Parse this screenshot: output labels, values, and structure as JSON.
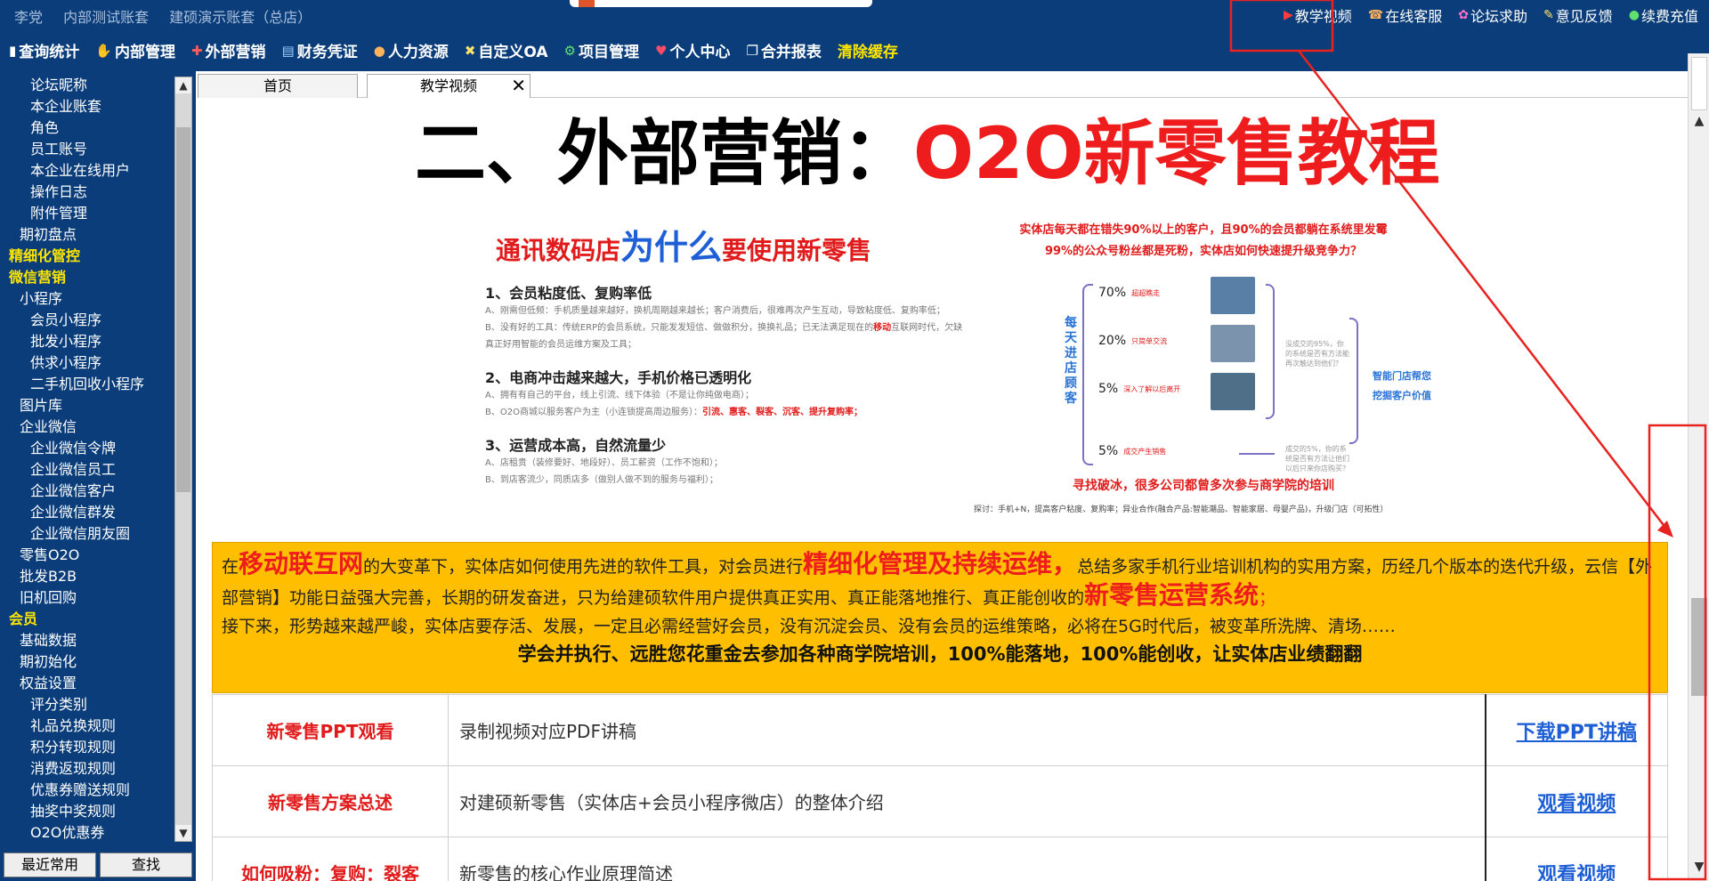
{
  "header": {
    "account_user": "李党",
    "account_test": "内部测试账套",
    "account_demo": "建硕演示账套（总店）",
    "util_links": {
      "video": "教学视频",
      "service": "在线客服",
      "forum": "论坛求助",
      "feedback": "意见反馈",
      "renew": "续费充值"
    },
    "nav": {
      "query": "查询统计",
      "internal": "内部管理",
      "marketing": "外部营销",
      "finance": "财务凭证",
      "hr": "人力资源",
      "oa": "自定义OA",
      "project": "项目管理",
      "personal": "个人中心",
      "report": "合并报表",
      "clear": "清除缓存"
    }
  },
  "sidebar": {
    "items": [
      "论坛昵称",
      "本企业账套",
      "角色",
      "员工账号",
      "本企业在线用户",
      "操作日志",
      "附件管理",
      "期初盘点",
      "精细化管控",
      "微信营销",
      "小程序",
      "会员小程序",
      "批发小程序",
      "供求小程序",
      "二手机回收小程序",
      "图片库",
      "企业微信",
      "企业微信令牌",
      "企业微信员工",
      "企业微信客户",
      "企业微信群发",
      "企业微信朋友圈",
      "零售O2O",
      "批发B2B",
      "旧机回购",
      "会员",
      "基础数据",
      "期初始化",
      "权益设置",
      "评分类别",
      "礼品兑换规则",
      "积分转现规则",
      "消费返现规则",
      "优惠券赠送规则",
      "抽奖中奖规则",
      "O2O优惠券"
    ],
    "bottom": {
      "recent": "最近常用",
      "search": "查找"
    }
  },
  "tabs": {
    "home": "首页",
    "video": "教学视频"
  },
  "content": {
    "title_black": "二、外部营销：",
    "title_red": "O2O新零售教程",
    "slide_left": {
      "title_a": "通讯数码店",
      "title_b": "为什么",
      "title_c": "要使用新零售",
      "p1": "1、会员粘度低、复购率低",
      "p1_a": "A、刚需但低频：手机质量越来越好，换机周期越来越长；客户消费后，很难再次产生互动，导致粘度低、复购率低；",
      "p1_b1": "B、没有好的工具：传统ERP的会员系统，只能发发短信、做做积分，换换礼品；已无法满足现在的",
      "p1_b_hl": "移动",
      "p1_b2": "互联网时代，欠缺真正好用智能的会员运维方案及工具；",
      "p2": "2、电商冲击越来越大，手机价格已透明化",
      "p2_a": "A、拥有有自己的平台，线上引流、线下体验（不是让你纯做电商）；",
      "p2_b1": "B、O2O商城以服务客户为主（小连锁提高周边服务）：",
      "p2_b_hl": "引流、惠客、裂客、沉客、提升复购率；",
      "p3": "3、运营成本高，自然流量少",
      "p3_a": "A、店租贵（装修要好、地段好）、员工薪资（工作不饱和）；",
      "p3_b": "B、到店客流少，同质店多（做别人做不到的服务与福利）；"
    },
    "slide_right": {
      "head_1": "实体店每天都在错失90%以上的客户，且90%的会员都躺在系统里发霉",
      "head_2": "99%的公众号粉丝都是死粉，实体店如何快速提升级竞争力？",
      "vertical": "每天进店顾客",
      "rows": [
        {
          "pct": "70%",
          "label": "超超瞧走"
        },
        {
          "pct": "20%",
          "label": "只简单交流"
        },
        {
          "pct": "5%",
          "label": "深入了解以后离开"
        },
        {
          "pct": "5%",
          "label": "成交产生销售"
        }
      ],
      "note_1": "没成交的95%，你的系统是否有方法能再次触达到他们？",
      "note_2": "成交的5%，你的系统是否有方法让他们以后只来你店购买？",
      "goal_1": "智能门店帮您",
      "goal_2": "挖掘客户价值",
      "bottom": "寻找破冰，很多公司都曾多次参与商学院的培训",
      "foot": "探讨：手机+N，提高客户粘度、复购率；异业合作(融合产品:智能潮品、智能家居、母婴产品)，升级门店（可拓性）"
    },
    "banner": {
      "t1": "在",
      "t1_red": "移动联互网",
      "t2": "的大变革下，实体店如何使用先进的软件工具，对会员进行",
      "t2_red": "精细化管理及持续运维，",
      "t3": "总结多家手机行业培训机构的实用方案，历经几个版本的迭代升级，云信【外部营销】功能日益强大完善，长期的研发奋进，只为给建硕软件用户提供真正实用、真正能落地推行、真正能创收的",
      "t3_red": "新零售运营系统",
      "t3_end": "；",
      "t4": "接下来，形势越来越严峻，实体店要存活、发展，一定且必需经营好会员，没有沉淀会员、没有会员的运维策略，必将在5G时代后，被变革所洗牌、清场……",
      "t5": "学会并执行、远胜您花重金去参加各种商学院培训，100%能落地，100%能创收，让实体店业绩翻翻"
    },
    "rows": [
      {
        "name": "新零售PPT观看",
        "desc": "录制视频对应PDF讲稿",
        "action": "下载PPT讲稿"
      },
      {
        "name": "新零售方案总述",
        "desc": "对建硕新零售（实体店+会员小程序微店）的整体介绍",
        "action": "观看视频"
      },
      {
        "name": "如何吸粉：复购：裂客",
        "desc": "新零售的核心作业原理简述",
        "action": "观看视频"
      }
    ]
  },
  "colors": {
    "header_bg": "#0a3d7a",
    "accent_yellow": "#ffe600",
    "banner_bg": "#ffbf00",
    "brand_red": "#ee1c1c",
    "link_blue": "#1e5fd6",
    "annotation_red": "#e8221e"
  }
}
